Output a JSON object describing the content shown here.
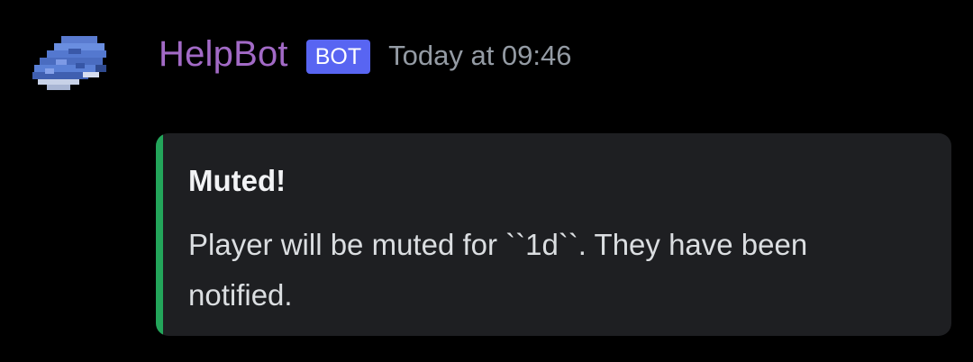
{
  "message": {
    "author": "HelpBot",
    "badge": "BOT",
    "timestamp": "Today at 09:46",
    "avatar_icon": "book-icon",
    "colors": {
      "username": "#a26ac6",
      "badge": "#5865f2",
      "embed_accent": "#23a55a",
      "embed_background": "#1e1f22"
    },
    "embed": {
      "title": "Muted!",
      "description": "Player will be muted for ``1d``. They have been notified."
    }
  }
}
